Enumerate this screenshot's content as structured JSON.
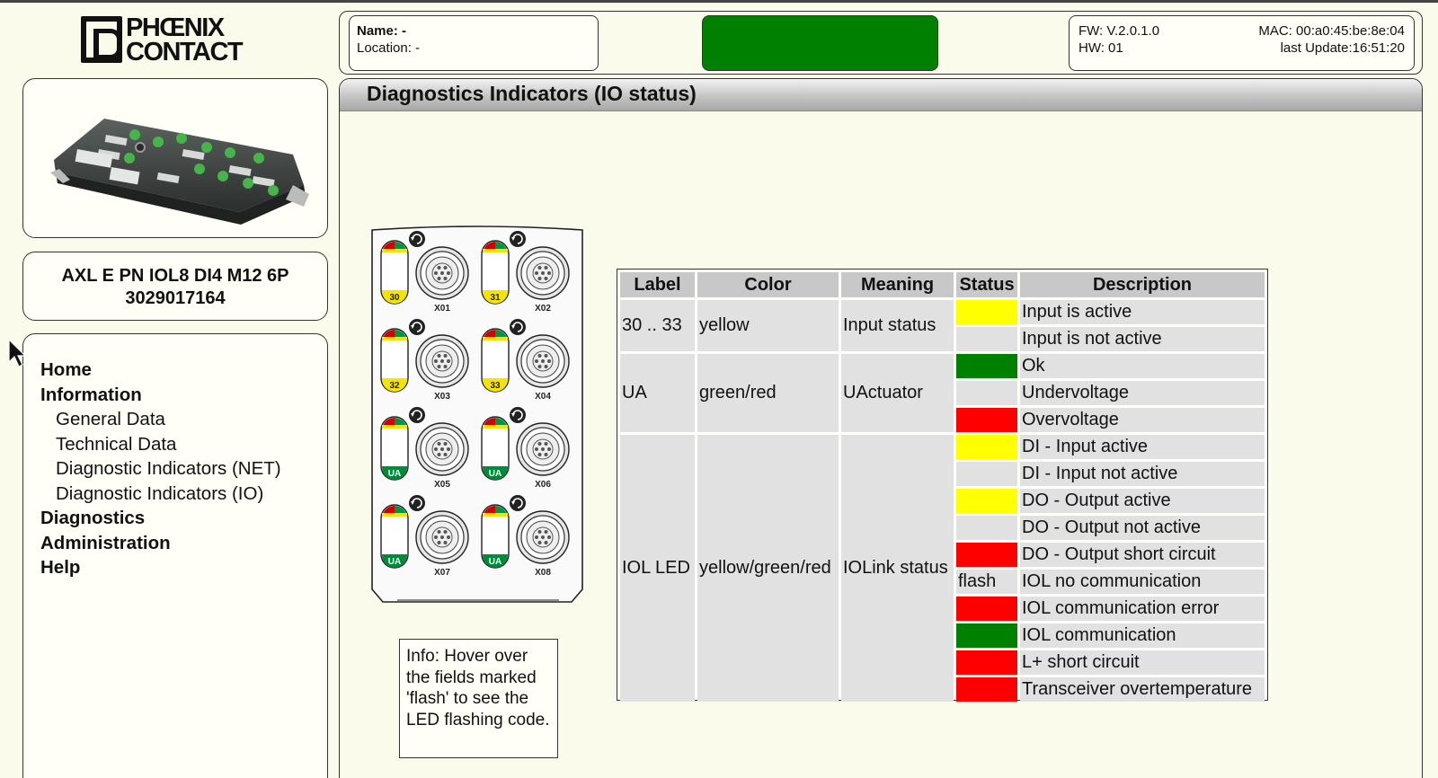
{
  "brand": {
    "line1": "PHŒNIX",
    "line2": "CONTACT"
  },
  "device": {
    "model": "AXL E PN IOL8 DI4 M12 6P",
    "article": "3029017164",
    "ports": [
      {
        "label": "X01",
        "led": "30",
        "led_color": "#f5e400"
      },
      {
        "label": "X02",
        "led": "31",
        "led_color": "#f5e400"
      },
      {
        "label": "X03",
        "led": "32",
        "led_color": "#f5e400"
      },
      {
        "label": "X04",
        "led": "33",
        "led_color": "#f5e400"
      },
      {
        "label": "X05",
        "led": "UA",
        "led_color": "#008b3a"
      },
      {
        "label": "X06",
        "led": "UA",
        "led_color": "#008b3a"
      },
      {
        "label": "X07",
        "led": "UA",
        "led_color": "#008b3a"
      },
      {
        "label": "X08",
        "led": "UA",
        "led_color": "#008b3a"
      }
    ]
  },
  "nav": {
    "items": [
      {
        "label": "Home",
        "level": 0
      },
      {
        "label": "Information",
        "level": 0
      },
      {
        "label": "General Data",
        "level": 1
      },
      {
        "label": "Technical Data",
        "level": 1
      },
      {
        "label": "Diagnostic Indicators (NET)",
        "level": 1
      },
      {
        "label": "Diagnostic Indicators (IO)",
        "level": 1
      },
      {
        "label": "Diagnostics",
        "level": 0
      },
      {
        "label": "Administration",
        "level": 0
      },
      {
        "label": "Help",
        "level": 0
      }
    ]
  },
  "header": {
    "name_label": "Name: -",
    "location_label": "Location: -",
    "status_color": "#008000",
    "fw": "FW: V.2.0.1.0",
    "hw": "HW: 01",
    "mac": "MAC: 00:a0:45:be:8e:04",
    "last_update": "last Update:16:51:20"
  },
  "page": {
    "title": "Diagnostics Indicators (IO status)",
    "info": "Info: Hover over the fields marked 'flash' to see the LED flashing code."
  },
  "table": {
    "headers": [
      "Label",
      "Color",
      "Meaning",
      "Status",
      "Description"
    ],
    "groups": [
      {
        "label": "30 .. 33",
        "color": "yellow",
        "meaning": "Input status",
        "rows": [
          {
            "status_color": "#ffff00",
            "status_text": "",
            "description": "Input is active"
          },
          {
            "status_color": "#e1e1e1",
            "status_text": "",
            "description": "Input is not active"
          }
        ]
      },
      {
        "label": "UA",
        "color": "green/red",
        "meaning": "UActuator",
        "rows": [
          {
            "status_color": "#008000",
            "status_text": "",
            "description": "Ok"
          },
          {
            "status_color": "#e1e1e1",
            "status_text": "",
            "description": "Undervoltage"
          },
          {
            "status_color": "#ff0000",
            "status_text": "",
            "description": "Overvoltage"
          }
        ]
      },
      {
        "label": "IOL LED",
        "color": "yellow/green/red",
        "meaning": "IOLink status",
        "rows": [
          {
            "status_color": "#ffff00",
            "status_text": "",
            "description": "DI - Input active"
          },
          {
            "status_color": "#e1e1e1",
            "status_text": "",
            "description": "DI - Input not active"
          },
          {
            "status_color": "#ffff00",
            "status_text": "",
            "description": "DO - Output active"
          },
          {
            "status_color": "#e1e1e1",
            "status_text": "",
            "description": "DO - Output not active"
          },
          {
            "status_color": "#ff0000",
            "status_text": "",
            "description": "DO - Output short circuit"
          },
          {
            "status_color": "#e1e1e1",
            "status_text": "flash",
            "description": "IOL no communication"
          },
          {
            "status_color": "#ff0000",
            "status_text": "",
            "description": "IOL communication error"
          },
          {
            "status_color": "#008000",
            "status_text": "",
            "description": "IOL communication"
          },
          {
            "status_color": "#ff0000",
            "status_text": "",
            "description": "L+ short circuit"
          },
          {
            "status_color": "#ff0000",
            "status_text": "",
            "description": "Transceiver overtemperature"
          }
        ]
      }
    ]
  }
}
